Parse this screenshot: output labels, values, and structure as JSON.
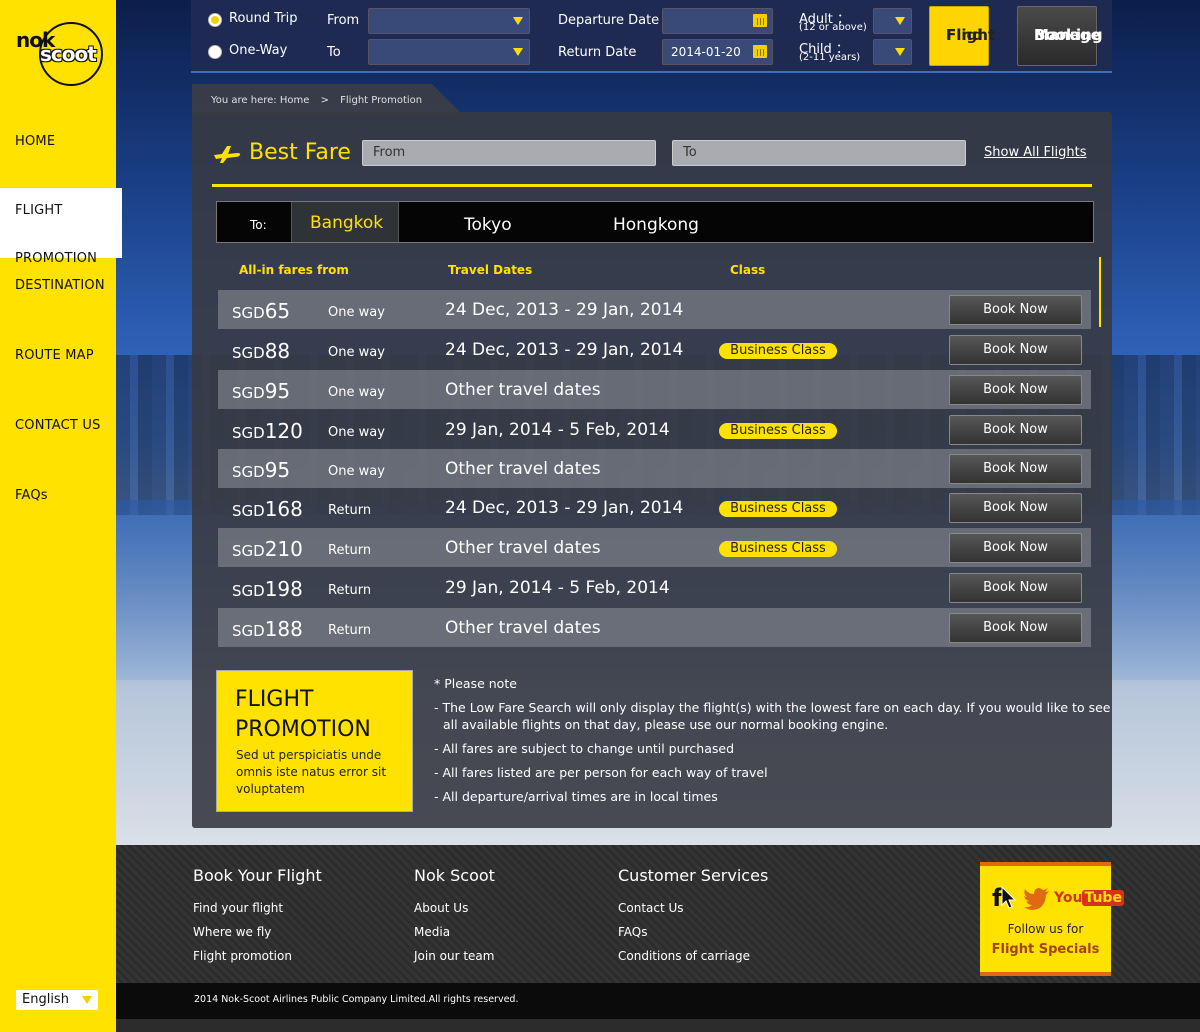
{
  "brand": {
    "logo_top": "nok",
    "logo_bottom": "scoot"
  },
  "sidebar": {
    "items": [
      {
        "label": "HOME"
      },
      {
        "label_line1": "FLIGHT",
        "label_line2": "PROMOTION",
        "active": true
      },
      {
        "label": "DESTINATION"
      },
      {
        "label": "ROUTE MAP"
      },
      {
        "label": "CONTACT US"
      },
      {
        "label": "FAQs"
      }
    ],
    "language": "English"
  },
  "search": {
    "trip_round": "Round Trip",
    "trip_oneway": "One-Way",
    "selected_trip": "Round Trip",
    "from_label": "From",
    "to_label": "To",
    "from_value": "",
    "to_value": "",
    "departure_label": "Departure Date",
    "departure_value": "",
    "return_label": "Return Date",
    "return_value": "2014-01-20",
    "adult_label": "Adult ：",
    "adult_sub": "(12 or above)",
    "child_label": "Child ：",
    "child_sub": "(2-11 years)",
    "find_line1": "Find",
    "find_line2": "Flight",
    "manage_line1": "Manage",
    "manage_line2": "Booking"
  },
  "breadcrumb": {
    "prefix": "You are here:",
    "home": "Home",
    "sep": ">",
    "current": "Flight Promotion"
  },
  "best_fare": {
    "title": "Best Fare",
    "from_placeholder": "From",
    "to_placeholder": "To",
    "show_all": "Show All Flights"
  },
  "destinations": {
    "to_label": "To:",
    "tabs": [
      "Bangkok",
      "Tokyo",
      "Hongkong"
    ],
    "selected": "Bangkok"
  },
  "table": {
    "headers": [
      "All-in fares from",
      "Travel Dates",
      "Class"
    ],
    "book_label": "Book Now",
    "rows": [
      {
        "currency": "SGD",
        "amount": "65",
        "trip": "One way",
        "dates": "24 Dec, 2013 - 29 Jan, 2014",
        "class": ""
      },
      {
        "currency": "SGD",
        "amount": "88",
        "trip": "One way",
        "dates": "24 Dec, 2013 - 29 Jan, 2014",
        "class": "Business Class"
      },
      {
        "currency": "SGD",
        "amount": "95",
        "trip": "One way",
        "dates": "Other travel dates",
        "class": ""
      },
      {
        "currency": "SGD",
        "amount": "120",
        "trip": "One way",
        "dates": "29 Jan, 2014 - 5 Feb, 2014",
        "class": "Business Class"
      },
      {
        "currency": "SGD",
        "amount": "95",
        "trip": "One way",
        "dates": "Other travel dates",
        "class": ""
      },
      {
        "currency": "SGD",
        "amount": "168",
        "trip": "Return",
        "dates": "24 Dec, 2013 - 29 Jan, 2014",
        "class": "Business Class"
      },
      {
        "currency": "SGD",
        "amount": "210",
        "trip": "Return",
        "dates": "Other travel dates",
        "class": "Business Class"
      },
      {
        "currency": "SGD",
        "amount": "198",
        "trip": "Return",
        "dates": "29 Jan, 2014 - 5 Feb, 2014",
        "class": ""
      },
      {
        "currency": "SGD",
        "amount": "188",
        "trip": "Return",
        "dates": "Other travel dates",
        "class": ""
      }
    ]
  },
  "promo": {
    "title_line1": "FLIGHT",
    "title_line2": "PROMOTION",
    "text": "Sed ut perspiciatis unde omnis iste natus error sit voluptatem"
  },
  "notes": {
    "heading": "* Please note",
    "line1a": "- The Low Fare Search will only display the flight(s) with the lowest fare on each day. If you would like to see",
    "line1b": "all available flights on that day, please use our normal booking engine.",
    "line2": "- All fares are subject to change until purchased",
    "line3": "- All fares listed are per person for each way of travel",
    "line4": "- All departure/arrival times are in local times"
  },
  "footer": {
    "col1": {
      "title": "Book Your Flight",
      "links": [
        "Find your flight",
        "Where we fly",
        "Flight promotion"
      ]
    },
    "col2": {
      "title": "Nok Scoot",
      "links": [
        "About Us",
        "Media",
        "Join our team"
      ]
    },
    "col3": {
      "title": "Customer Services",
      "links": [
        "Contact Us",
        "FAQs",
        "Conditions of carriage"
      ]
    },
    "social": {
      "fb": "f",
      "yt_you": "You",
      "yt_tube": "Tube",
      "follow": "Follow us for",
      "specials": "Flight Specials"
    },
    "copyright": "2014 Nok-Scoot Airlines Public Company Limited.All rights reserved."
  },
  "colors": {
    "brand_yellow": "#ffe200",
    "panel": "#37393f",
    "accent_orange": "#e06a10"
  }
}
